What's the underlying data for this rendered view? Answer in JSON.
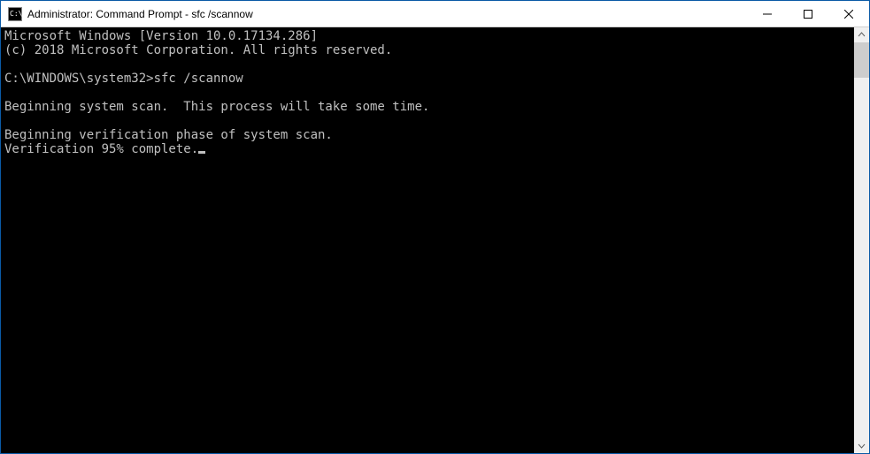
{
  "window": {
    "title": "Administrator: Command Prompt - sfc  /scannow"
  },
  "terminal": {
    "lines": [
      "Microsoft Windows [Version 10.0.17134.286]",
      "(c) 2018 Microsoft Corporation. All rights reserved.",
      "",
      "C:\\WINDOWS\\system32>sfc /scannow",
      "",
      "Beginning system scan.  This process will take some time.",
      "",
      "Beginning verification phase of system scan.",
      "Verification 95% complete."
    ],
    "cursor_after_last": true
  }
}
